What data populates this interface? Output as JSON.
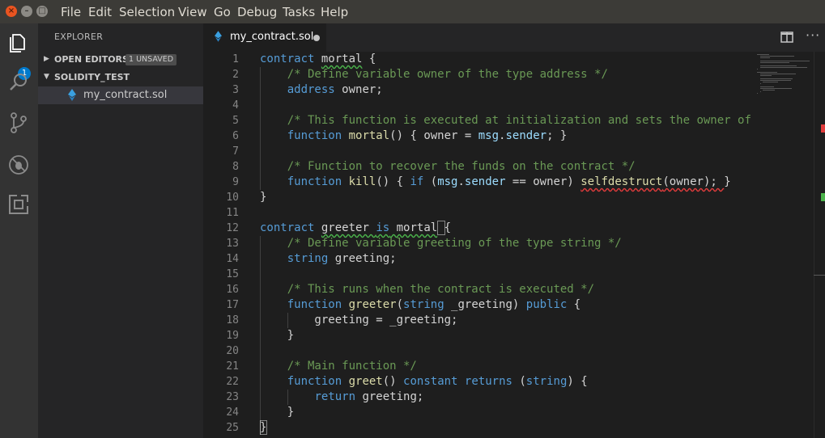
{
  "menubar": {
    "items": [
      "File",
      "Edit",
      "Selection",
      "View",
      "Go",
      "Debug",
      "Tasks",
      "Help"
    ]
  },
  "activity": {
    "explorer_badge": "1",
    "icons": [
      "files-icon",
      "search-icon",
      "source-control-icon",
      "debug-icon",
      "extensions-icon"
    ]
  },
  "sidebar": {
    "title": "EXPLORER",
    "open_editors_label": "OPEN EDITORS",
    "open_editors_badge": "1 UNSAVED",
    "project_label": "SOLIDITY_TEST",
    "file_name": "my_contract.sol"
  },
  "tab": {
    "name": "my_contract.sol"
  },
  "editor": {
    "line_numbers": [
      "1",
      "2",
      "3",
      "4",
      "5",
      "6",
      "7",
      "8",
      "9",
      "10",
      "11",
      "12",
      "13",
      "14",
      "15",
      "16",
      "17",
      "18",
      "19",
      "20",
      "21",
      "22",
      "23",
      "24",
      "25"
    ],
    "code": [
      "contract mortal {",
      "    /* Define variable owner of the type address */",
      "    address owner;",
      "",
      "    /* This function is executed at initialization and sets the owner of",
      "    function mortal() { owner = msg.sender; }",
      "",
      "    /* Function to recover the funds on the contract */",
      "    function kill() { if (msg.sender == owner) selfdestruct(owner); }",
      "}",
      "",
      "contract greeter is mortal {",
      "    /* Define variable greeting of the type string */",
      "    string greeting;",
      "",
      "    /* This runs when the contract is executed */",
      "    function greeter(string _greeting) public {",
      "        greeting = _greeting;",
      "    }",
      "",
      "    /* Main function */",
      "    function greet() constant returns (string) {",
      "        return greeting;",
      "    }",
      "}"
    ]
  },
  "colors": {
    "keyword": "#569cd6",
    "comment": "#6a9955",
    "function": "#dcdcaa",
    "variable": "#9cdcfe",
    "text": "#d4d4d4"
  }
}
